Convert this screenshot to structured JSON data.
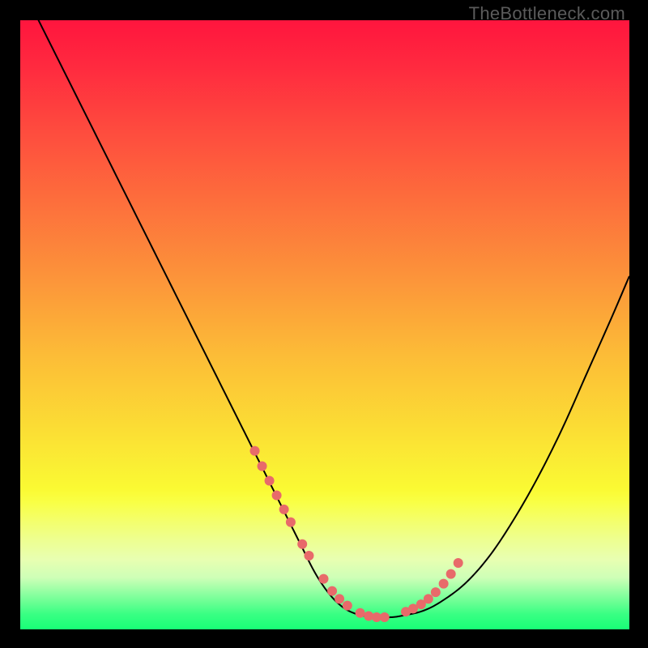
{
  "watermark": {
    "text": "TheBottleneck.com"
  },
  "colors": {
    "background": "#000000",
    "curve_stroke": "#000000",
    "dot_fill": "#e86a6a",
    "gradient_stops": [
      {
        "offset": 0.0,
        "color": "#ff153e"
      },
      {
        "offset": 0.08,
        "color": "#ff2b3f"
      },
      {
        "offset": 0.18,
        "color": "#fe4b3e"
      },
      {
        "offset": 0.3,
        "color": "#fd6f3c"
      },
      {
        "offset": 0.42,
        "color": "#fc933a"
      },
      {
        "offset": 0.55,
        "color": "#fcbc37"
      },
      {
        "offset": 0.68,
        "color": "#fbe034"
      },
      {
        "offset": 0.77,
        "color": "#fafa33"
      },
      {
        "offset": 0.79,
        "color": "#f9ff44"
      },
      {
        "offset": 0.82,
        "color": "#f4ff69"
      },
      {
        "offset": 0.85,
        "color": "#eeff8d"
      },
      {
        "offset": 0.885,
        "color": "#e8ffb1"
      },
      {
        "offset": 0.915,
        "color": "#ceffb7"
      },
      {
        "offset": 0.935,
        "color": "#9cffa6"
      },
      {
        "offset": 0.955,
        "color": "#6bff94"
      },
      {
        "offset": 0.975,
        "color": "#39ff83"
      },
      {
        "offset": 1.0,
        "color": "#18ff77"
      }
    ]
  },
  "chart_data": {
    "type": "line",
    "title": "",
    "xlabel": "",
    "ylabel": "",
    "xlim": [
      0,
      100
    ],
    "ylim": [
      0,
      100
    ],
    "series": [
      {
        "name": "bottleneck-curve",
        "x": [
          0,
          3,
          7,
          11,
          15,
          19,
          23,
          27,
          31,
          35,
          38,
          41,
          44,
          46,
          48,
          49.5,
          51,
          52.5,
          54,
          56,
          58.5,
          61,
          63,
          66,
          69,
          73,
          77,
          81,
          85,
          89,
          93,
          97,
          100
        ],
        "y": [
          106,
          100,
          92,
          84,
          76,
          68,
          60,
          52,
          44,
          36,
          30,
          24,
          18,
          14,
          10,
          7.5,
          5.5,
          4,
          3,
          2.3,
          2,
          2,
          2.3,
          3,
          4.5,
          7.5,
          12,
          18,
          25,
          33,
          42,
          51,
          58
        ]
      }
    ],
    "dots": {
      "name": "highlight-dots",
      "x": [
        38.5,
        39.7,
        40.9,
        42.1,
        43.3,
        44.4,
        46.3,
        47.4,
        49.8,
        51.2,
        52.4,
        53.7,
        55.8,
        57.2,
        58.5,
        59.8,
        63.3,
        64.5,
        65.8,
        67.0,
        68.2,
        69.5,
        70.7,
        71.9
      ],
      "y": [
        29.3,
        26.8,
        24.4,
        22.0,
        19.7,
        17.6,
        14.0,
        12.1,
        8.3,
        6.3,
        5.0,
        3.9,
        2.7,
        2.2,
        2.0,
        2.0,
        2.9,
        3.4,
        4.1,
        5.0,
        6.1,
        7.5,
        9.1,
        10.9
      ]
    }
  }
}
